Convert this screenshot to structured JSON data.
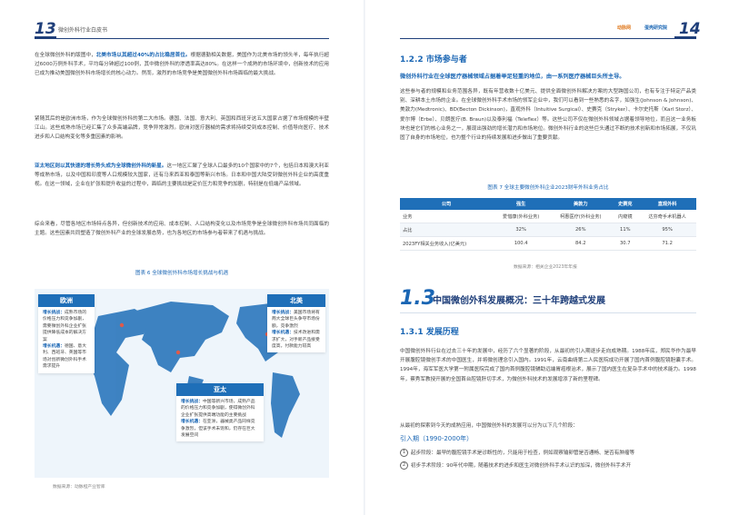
{
  "left": {
    "page_number": "13",
    "header_title": "微创外科行业白皮书",
    "p1": {
      "pre": "在全球微创外科的版图中，",
      "hl": "北美市场以其超过40%的占比稳居首位。",
      "post": "根据德勤相关数据，美国作为北美市场的领头羊，每年执行超过6000万例外科手术，平均每分钟超过100例，其中微创外科的渗透率高达80%。在这样一个成熟的市场环境中，创新技术的应用已成为推动美国微创外科市场增长的核心动力。然而，激烈的市场竞争是美国微创外科市场面临的最大挑战。"
    },
    "p2": "紧随其后的是欧洲市场，作为全球微创外科的第二大市场。德国、法国、意大利、英国和西班牙这五大国家占据了市场规模的半壁江山。这些成熟市场已经汇集了众多高端品牌，竞争异常激烈。欧洲对医疗器械的需求将持续受到成本控制、价值导向医疗、技术进步和人口结构变化等多重因素的影响。",
    "p3": {
      "hl": "亚太地区则以其快速的增长势头成为全球微创外科的新星。",
      "post": "这一地区汇聚了全球人口最多的10个国家中的7个，包括日本和澳大利亚等成熟市场，以及中国和印度等人口规模较大国家，还有马来西亚和泰国等新兴市场。日本和中国大陆受到微创外科企业的高度重视。在这一领域，企业在扩张和提升收益的过程中，面临的主要挑战是定价压力和竞争的加剧，特别是在低端产品领域。"
    },
    "p4": "综合来看，尽管各地区市场特点各异，但创新技术的应用、成本控制、人口结构变化以及市场竞争是全球微创外科市场共同面临的主题。这些因素共同塑造了微创外科产业的全球发展态势，也为各地区的市场参与者带来了机遇与挑战。",
    "figure_caption": "图表 6 全球微创外科市场增长挑战与机遇",
    "regions": {
      "europe": {
        "name": "欧洲",
        "lines": [
          {
            "k": "增长挑战：",
            "v": "成熟市场的价格压力和竞争加剧，需要微创外科企业扩张提供降低成本的解决方案"
          },
          {
            "k": "增长机遇：",
            "v": "德国、意大利、西班牙、英国等市场对创新微创外科手术需求提升"
          }
        ]
      },
      "north_america": {
        "name": "北美",
        "lines": [
          {
            "k": "增长挑战：",
            "v": "美国市场将有两大全球巨头争夺市场份额，竞争激烈"
          },
          {
            "k": "增长机遇：",
            "v": "技术改进和需求扩大，对手新产品接受度高，付款能力较高"
          }
        ]
      },
      "asia_pacific": {
        "name": "亚太",
        "lines": [
          {
            "k": "增长挑战：",
            "v": "中国等新兴市场，成熟产品的价格压力和竞争加剧，使得微创外科企业扩张提供高端功能的主要挑战"
          },
          {
            "k": "增长机遇：",
            "v": "在亚洲，器械类产品同样竞争激烈，但该手术未饱和，仍存在巨大发展空间"
          }
        ]
      }
    },
    "source": "数据来源：动脉橙产业智库"
  },
  "right": {
    "page_number": "14",
    "logos": [
      "动脉网",
      "蛋壳研究院"
    ],
    "section_122": "1.2.2 市场参与者",
    "lead": "微创外科行业在全球医疗器械领域占据着举足轻重的地位，由一系列医疗器械巨头所主导。",
    "para": "这些参与者的规模和业务范围各异，既有年营收数十亿美元、提供全面微创外科解决方案的大型跨国公司，也有专注于特定产品类别、深耕本土市场的企业。在全球微创外科手术市场的领军企业中，我们可以看到一些熟悉的名字，如强生(Johnson & Johnson)、美敦力(Medtronic)、BD(Becton Dickinson)，直观外科（Intuitive Surgical）、史赛克（Stryker）、卡尔史托斯（Karl Storz）、爱尔博（Erbe）、贝朗医疗(B. Braun)以及泰利福（Teleflex）等。这些公司不仅在微创外科领域占据着领导地位，而且这一业务板块也是它们的核心业务之一，展现出强劲的增长潜力和市场地位。微创外科行业的这些巨头通过不断的技术创新和市场拓展，不仅巩固了自身的市场地位，也为整个行业的持续发展和进步做出了重要贡献。",
    "table_caption": "图表 7 全球主要微创外科企业2023财年外科业务占比",
    "table": {
      "headers": [
        "公司",
        "强生",
        "美敦力",
        "史赛克",
        "直观外科"
      ],
      "rows": [
        [
          "业务",
          "爱惜康(外科业务)",
          "柯惠医疗(外科业务)",
          "内窥镜",
          "达芬奇手术机器人"
        ],
        [
          "占比",
          "32%",
          "26%",
          "11%",
          "95%"
        ],
        [
          "2023FY相关业务收入(亿美元)",
          "100.4",
          "84.2",
          "30.7",
          "71.2"
        ]
      ]
    },
    "table_source": "数据来源：相关企业2023年年报",
    "section_13_num": "1.3",
    "section_13_title": "中国微创外科发展概况：三十年跨越式发展",
    "section_131": "1.3.1 发展历程",
    "para2": "中国微创外科行业在过去三十年的发展中，经历了六个显著的阶段，从最初的引入期逐步走向成熟期。1988年底，郑民华作为最早开展腹腔镜微创手术的中国医生，并将微创理念引入国内。1991年，云南曲靖第二人民医院成功开展了国内首例腹腔镜胆囊手术。1994年，海军军医大学第一附属医院完成了国内首例腹腔镜辅助远端胃癌根治术，展示了国内医生在复杂手术中的技术能力。1998年，蔡秀军教授开展的全国首台腔镜肝切手术，为微创外科技术的发展增添了新的里程碑。",
    "para3": "从最初的探索到今天的成熟应用，中国微创外科的发展可以分为以下几个阶段：",
    "stage1": "引入期（1990-2000年）",
    "items": [
      {
        "n": "1",
        "text": "起步阶段：最早的腹腔镜手术是诊断性的，只能用于检查，例如观察输卵管是否通畅、是否有肿瘤等"
      },
      {
        "n": "2",
        "text": "初步手术阶段：90年代中期，随着技术的进步和医生对微创外科手术认识的加深，微创外科手术开"
      }
    ]
  }
}
